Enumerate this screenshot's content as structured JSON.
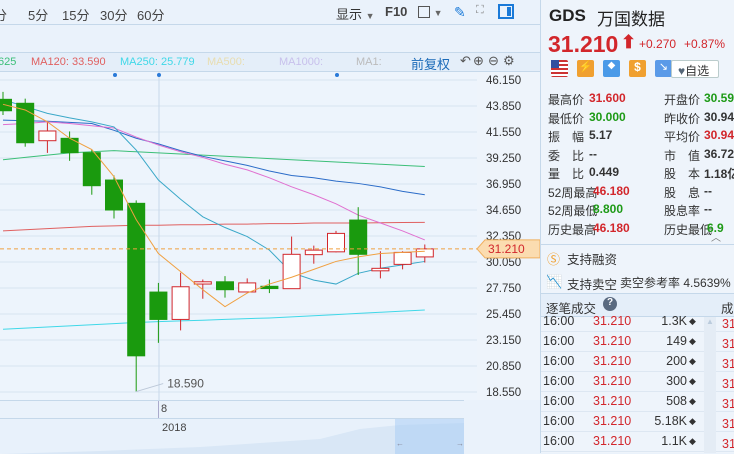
{
  "toolbar": {
    "periods": [
      "分",
      "5分",
      "15分",
      "30分",
      "60分"
    ],
    "display": "显示",
    "f10": "F10"
  },
  "ma_legend": {
    "ma60_tail": "625",
    "ma120": "MA120: 33.590",
    "ma250": "MA250: 25.779",
    "ma500": "MA500:",
    "ma1000": "MA1000:",
    "ma1": "MA1:",
    "adjust": "前复权"
  },
  "colors": {
    "up": "#d2262b",
    "down": "#1a9a0e",
    "ma5": "#f0a040",
    "ma10": "#3aa8c8",
    "ma20": "#e070d0",
    "ma30": "#2b6cc8",
    "ma60": "#3cbf78",
    "ma120": "#e06060",
    "ma250": "#40d8e8"
  },
  "chart_data": {
    "type": "candlestick",
    "ylim": [
      18.55,
      46.15
    ],
    "y_ticks": [
      "46.150",
      "43.850",
      "41.550",
      "39.250",
      "36.950",
      "34.650",
      "32.350",
      "30.050",
      "27.750",
      "25.450",
      "23.150",
      "20.850",
      "18.550"
    ],
    "current_price": "31.210",
    "low_annotation": "18.590",
    "x_tick": "8",
    "x_year": "2018",
    "candles": [
      [
        44.44,
        43.43,
        45.1,
        43.05
      ],
      [
        44.09,
        40.6,
        44.5,
        40.25
      ],
      [
        40.78,
        41.64,
        42.4,
        39.7
      ],
      [
        40.99,
        39.72,
        41.6,
        39.0
      ],
      [
        39.72,
        36.8,
        40.0,
        36.0
      ],
      [
        37.3,
        34.65,
        37.7,
        33.9
      ],
      [
        35.24,
        21.75,
        35.5,
        18.59
      ],
      [
        27.39,
        24.97,
        28.2,
        22.9
      ],
      [
        24.97,
        27.86,
        29.1,
        24.0
      ],
      [
        28.1,
        28.3,
        28.5,
        26.8
      ],
      [
        28.3,
        27.6,
        28.8,
        26.9
      ],
      [
        27.4,
        28.2,
        28.6,
        27.4
      ],
      [
        27.9,
        27.7,
        28.5,
        27.3
      ],
      [
        27.69,
        30.73,
        32.3,
        27.69
      ],
      [
        30.7,
        31.1,
        31.5,
        29.9
      ],
      [
        30.95,
        32.58,
        32.8,
        30.9
      ],
      [
        33.76,
        30.73,
        34.9,
        28.9
      ],
      [
        29.27,
        29.49,
        31.0,
        28.6
      ],
      [
        29.84,
        30.9,
        31.0,
        29.4
      ],
      [
        30.5,
        31.21,
        31.6,
        30.0
      ]
    ],
    "ma": {
      "ma5": [
        44.0,
        43.5,
        42.45,
        41.0,
        40.0,
        37.6,
        33.8,
        30.8,
        29.2,
        27.6,
        26.1,
        27.3,
        28.1,
        28.7,
        29.4,
        30.1,
        30.5,
        30.8,
        30.9,
        31.0
      ],
      "ma10": [
        44.4,
        43.8,
        43.2,
        42.8,
        42.45,
        42.0,
        39.95,
        37.3,
        35.6,
        34.05,
        33.1,
        32.3,
        31.1,
        29.1,
        28.45,
        28.1,
        29.05,
        29.5,
        29.8,
        30.1
      ],
      "ma20": [
        42.2,
        42.3,
        42.45,
        42.3,
        42.1,
        41.9,
        41.1,
        40.4,
        39.8,
        39.3,
        38.7,
        38.2,
        37.5,
        36.7,
        36.0,
        35.2,
        34.2,
        33.5,
        32.8,
        32.0
      ],
      "ma30": [
        42.6,
        42.55,
        42.5,
        42.4,
        42.3,
        41.7,
        41.0,
        40.5,
        39.9,
        39.4,
        39.0,
        38.6,
        38.1,
        37.7,
        37.5,
        37.2,
        37.0,
        36.7,
        36.3,
        36.0
      ],
      "ma60": [
        39.1,
        39.3,
        39.5,
        39.7,
        39.8,
        39.9,
        39.8,
        39.7,
        39.6,
        39.5,
        39.4,
        39.3,
        39.2,
        39.1,
        39.0,
        38.9,
        38.8,
        38.7,
        38.6,
        38.5
      ],
      "ma120": [
        32.8,
        32.9,
        33.0,
        33.1,
        33.2,
        33.25,
        33.3,
        33.3,
        33.35,
        33.35,
        33.4,
        33.4,
        33.45,
        33.45,
        33.5,
        33.5,
        33.5,
        33.52,
        33.54,
        33.55
      ],
      "ma250": [
        24.1,
        24.2,
        24.3,
        24.4,
        24.5,
        24.6,
        24.7,
        24.77,
        24.84,
        24.9,
        24.97,
        25.04,
        25.1,
        25.2,
        25.3,
        25.4,
        25.5,
        25.6,
        25.7,
        25.8
      ]
    }
  },
  "stock": {
    "ticker": "GDS",
    "name": "万国数据",
    "price": "31.210",
    "change": "+0.270",
    "pct": "+0.87%",
    "watch": "自选"
  },
  "stats": {
    "left": [
      [
        "最高价",
        "31.600",
        "red"
      ],
      [
        "最低价",
        "30.000",
        "green"
      ],
      [
        "振　幅",
        "5.17",
        "dark"
      ],
      [
        "委　比",
        "--",
        "dark"
      ],
      [
        "量　比",
        "0.449",
        "dark"
      ],
      [
        "52周最高",
        "46.180",
        "red"
      ],
      [
        "52周最低",
        "8.800",
        "green"
      ],
      [
        "历史最高",
        "46.180",
        "red"
      ]
    ],
    "right": [
      [
        "开盘价",
        "30.59",
        "green"
      ],
      [
        "昨收价",
        "30.94",
        "dark"
      ],
      [
        "平均价",
        "30.94",
        "red"
      ],
      [
        "市　值",
        "36.72",
        "dark"
      ],
      [
        "股　本",
        "1.18亿",
        "dark"
      ],
      [
        "股　息",
        "--",
        "dark"
      ],
      [
        "股息率",
        "--",
        "dark"
      ],
      [
        "历史最低",
        "6.9",
        "green"
      ]
    ]
  },
  "features": {
    "margin": "支持融资",
    "short": "支持卖空",
    "short_rate": "卖空参考率 4.5639%"
  },
  "trades": {
    "title": "逐笔成交",
    "col2": "成",
    "rows": [
      [
        "16:00",
        "31.210",
        "1.3K"
      ],
      [
        "16:00",
        "31.210",
        "149"
      ],
      [
        "16:00",
        "31.210",
        "200"
      ],
      [
        "16:00",
        "31.210",
        "300"
      ],
      [
        "16:00",
        "31.210",
        "508"
      ],
      [
        "16:00",
        "31.210",
        "5.18K"
      ],
      [
        "16:00",
        "31.210",
        "1.1K"
      ]
    ],
    "side_prices": [
      "31",
      "31",
      "31",
      "31",
      "31",
      "31",
      "31"
    ]
  }
}
